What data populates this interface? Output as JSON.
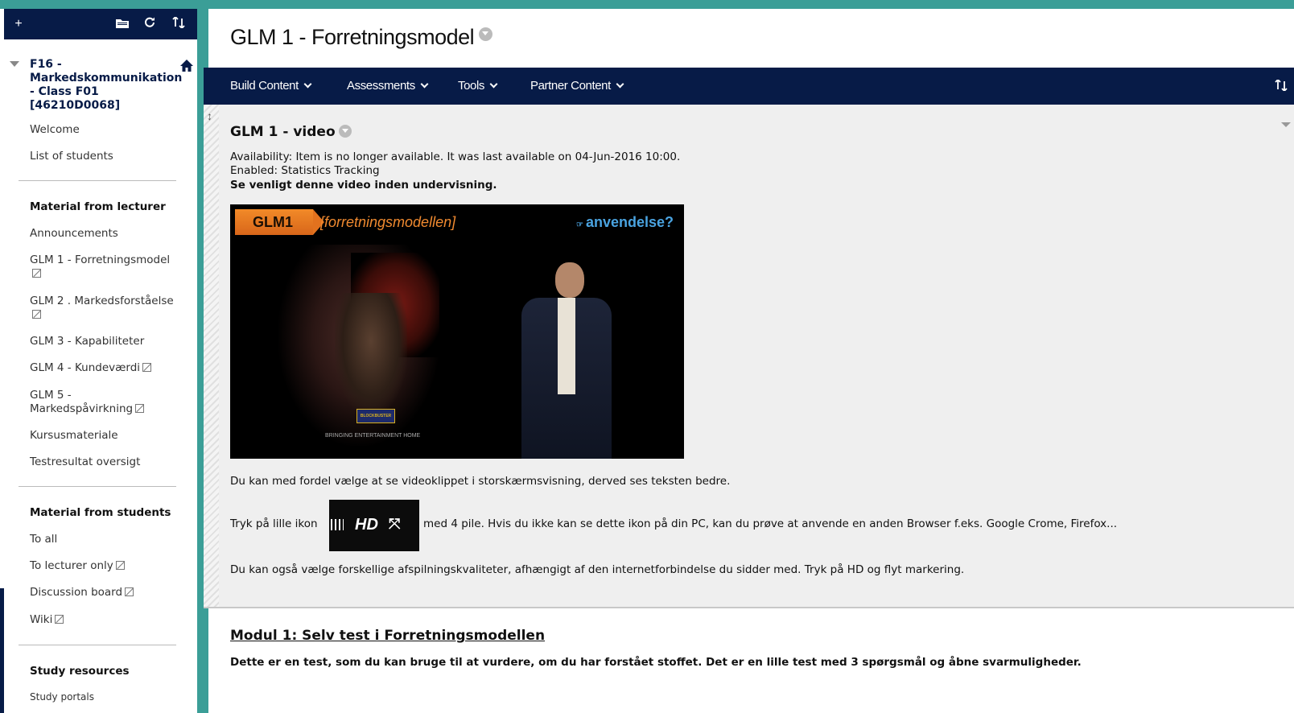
{
  "sidebar": {
    "toolbar": {
      "add_icon": "plus-icon",
      "folder_icon": "folder-icon",
      "refresh_icon": "refresh-icon",
      "sort_icon": "sort-icon"
    },
    "course_title": "F16 - Markedskommunikation - Class F01 [46210D0068]",
    "course_items": [
      {
        "label": "Welcome"
      },
      {
        "label": "List of students"
      }
    ],
    "sections": [
      {
        "heading": "Material from lecturer",
        "items": [
          {
            "label": "Announcements"
          },
          {
            "label": "GLM 1 - Forretningsmodel"
          },
          {
            "label": "GLM 2 . Markedsforståelse"
          },
          {
            "label": "GLM 3 - Kapabiliteter"
          },
          {
            "label": "GLM 4 - Kundeværdi"
          },
          {
            "label": "GLM 5 - Markedspåvirkning"
          },
          {
            "label": "Kursusmateriale"
          },
          {
            "label": "Testresultat oversigt"
          }
        ]
      },
      {
        "heading": "Material from students",
        "items": [
          {
            "label": "To all"
          },
          {
            "label": "To lecturer only"
          },
          {
            "label": "Discussion board"
          },
          {
            "label": "Wiki"
          }
        ]
      },
      {
        "heading": "Study resources",
        "items": [
          {
            "label": "Study portals"
          }
        ]
      }
    ]
  },
  "main": {
    "page_title": "GLM 1 - Forretningsmodel",
    "menu": [
      "Build Content",
      "Assessments",
      "Tools",
      "Partner Content"
    ],
    "item": {
      "title": "GLM 1 - video",
      "availability": "Availability:  Item is no longer available. It was last available on 04-Jun-2016 10:00.",
      "enabled": "Enabled:  Statistics Tracking",
      "intro": "Se venligt denne video inden undervisning.",
      "video": {
        "badge": "GLM1",
        "subtitle": "[forretningsmodellen]",
        "question": "anvendelse?",
        "sign": "BLOCKBUSTER",
        "tagline": "BRINGING ENTERTAINMENT HOME"
      },
      "para1": "Du kan med fordel vælge at se videoklippet i storskærmsvisning, derved ses teksten bedre.",
      "para2_before": "Tryk på lille ikon",
      "hd_label": "HD",
      "para2_after": "med 4 pile. Hvis du ikke kan se dette ikon på din PC, kan du prøve at anvende en anden Browser f.eks. Google Crome, Firefox...",
      "para3": "Du kan også vælge forskellige afspilningskvaliteter, afhængigt af den internetforbindelse du sidder med. Tryk på HD og flyt markering."
    },
    "modul": {
      "title": "Modul 1: Selv test i Forretningsmodellen",
      "description": "Dette er en test, som du kan bruge til at vurdere, om du har forstået stoffet. Det er en lille test med 3 spørgsmål og åbne svarmuligheder."
    }
  },
  "colors": {
    "navy": "#071b47",
    "teal": "#3b9e97",
    "orange": "#f28a28",
    "link_blue": "#4aa3e0"
  }
}
